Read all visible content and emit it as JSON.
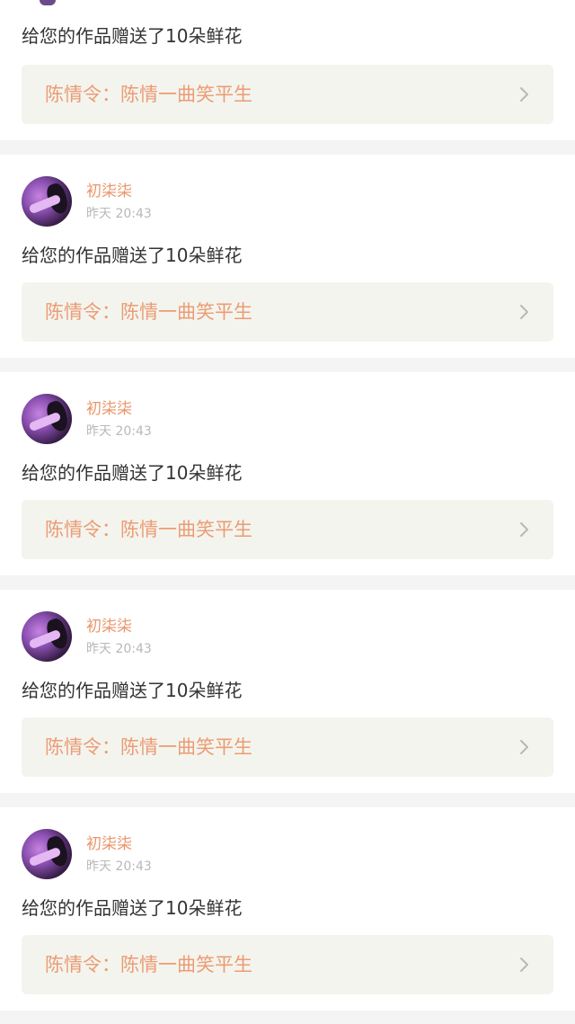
{
  "notifications": [
    {
      "username": "",
      "time": "",
      "message": "给您的作品赠送了10朵鲜花",
      "work_title": "陈情令：陈情一曲笑平生"
    },
    {
      "username": "初柒柒",
      "time": "昨天 20:43",
      "message": "给您的作品赠送了10朵鲜花",
      "work_title": "陈情令：陈情一曲笑平生"
    },
    {
      "username": "初柒柒",
      "time": "昨天 20:43",
      "message": "给您的作品赠送了10朵鲜花",
      "work_title": "陈情令：陈情一曲笑平生"
    },
    {
      "username": "初柒柒",
      "time": "昨天 20:43",
      "message": "给您的作品赠送了10朵鲜花",
      "work_title": "陈情令：陈情一曲笑平生"
    },
    {
      "username": "初柒柒",
      "time": "昨天 20:43",
      "message": "给您的作品赠送了10朵鲜花",
      "work_title": "陈情令：陈情一曲笑平生"
    }
  ],
  "icons": {
    "chevron": "chevron-right-icon",
    "avatar": "user-avatar"
  },
  "colors": {
    "username": "#e9956b",
    "work_title": "#eb9c74",
    "work_background": "#f4f4ee",
    "time": "#b8b8b8",
    "message": "#333333",
    "page_background": "#f5f4f4"
  }
}
